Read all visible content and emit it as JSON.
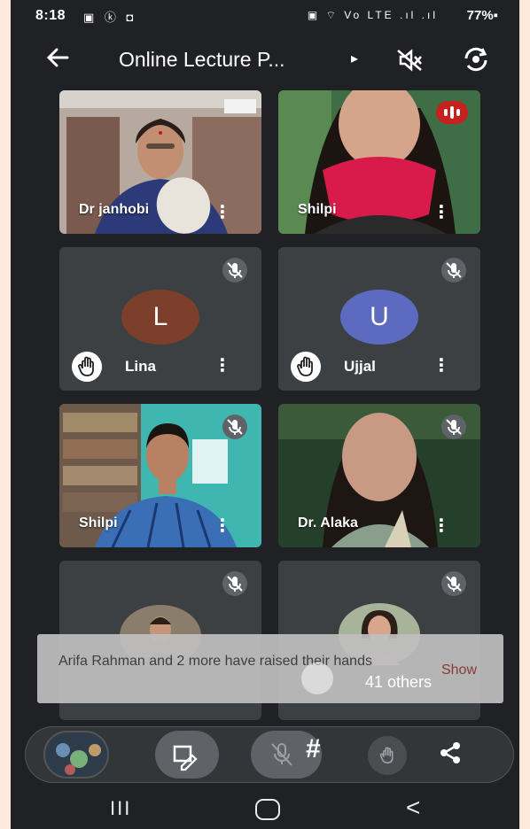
{
  "status_bar": {
    "time": "8:18",
    "left_icons": "▣ ⓚ ◘",
    "right_icons": "▣ ⌔ Vo LTE .ıl .ıl",
    "battery": "77%▪"
  },
  "header": {
    "back_icon": "arrow-left-icon",
    "title": "Online Lecture P...",
    "chevron": "▸"
  },
  "participants": [
    {
      "name": "Dr janhobi",
      "type": "video"
    },
    {
      "name": "Shilpi",
      "type": "video",
      "speaking": true
    },
    {
      "name": "Lina",
      "type": "avatar",
      "initial": "L",
      "color": "#7b3f2b",
      "hand_raised": true
    },
    {
      "name": "Ujjal",
      "type": "avatar",
      "initial": "U",
      "color": "#5c6bc0",
      "hand_raised": true
    },
    {
      "name": "Shilpi",
      "type": "video",
      "muted": true
    },
    {
      "name": "Dr. Alaka",
      "type": "video",
      "muted": true
    }
  ],
  "toast": {
    "message": "Arifa Rahman and 2 more have raised their hands",
    "action": "Show"
  },
  "others_label": "41 others",
  "controls": {
    "hash": "#"
  },
  "navbar": {
    "recent": "III",
    "back": "<"
  }
}
